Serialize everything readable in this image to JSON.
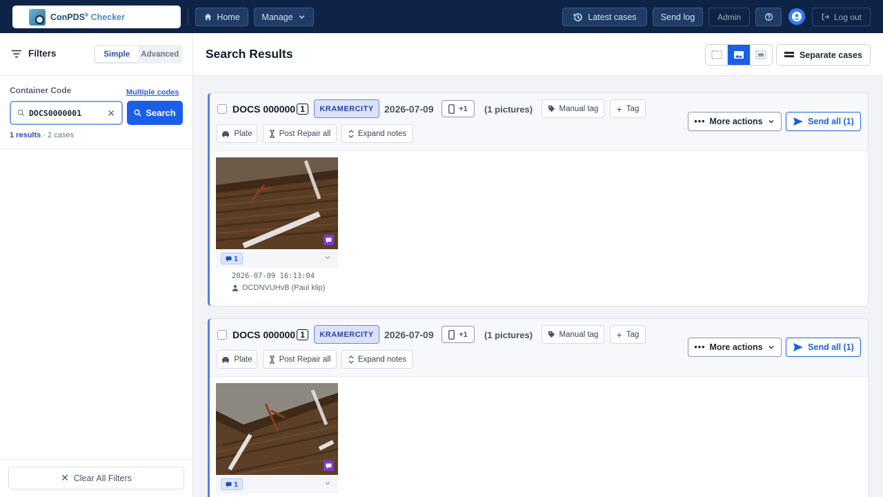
{
  "app": {
    "logo_name": "ConPDS",
    "logo_suffix": "Checker",
    "logo_reg": "®"
  },
  "topbar": {
    "home": "Home",
    "manage": "Manage",
    "latest": "Latest cases",
    "sendlog": "Send log",
    "admin": "Admin",
    "logout": "Log out"
  },
  "sidebar": {
    "title": "Filters",
    "mode_simple": "Simple",
    "mode_advanced": "Advanced",
    "container_label": "Container Code",
    "multiple_link": "Multiple codes",
    "search_value": "DOCS0000001",
    "search_button": "Search",
    "results_count": "1 results",
    "results_cases": "· 2 cases",
    "clear_all": "Clear All Filters"
  },
  "main": {
    "title": "Search Results",
    "separate": "Separate cases"
  },
  "cards": [
    {
      "code": "DOCS 000000",
      "code_num": "1",
      "city": "KRAMERCITY",
      "date": "2026-07-09",
      "device": "+1",
      "pictures": "(1 pictures)",
      "manual_tag": "Manual tag",
      "tag": "Tag",
      "plate": "Plate",
      "post_repair": "Post Repair all",
      "expand": "Expand notes",
      "more": "More actions",
      "send": "Send all (1)",
      "note_count": "1",
      "photo_time": "2026-07-09 16:13:04",
      "photo_user": "OCDNVUHvB (Paul klip)"
    },
    {
      "code": "DOCS 000000",
      "code_num": "1",
      "city": "KRAMERCITY",
      "date": "2026-07-09",
      "device": "+1",
      "pictures": "(1 pictures)",
      "manual_tag": "Manual tag",
      "tag": "Tag",
      "plate": "Plate",
      "post_repair": "Post Repair all",
      "expand": "Expand notes",
      "more": "More actions",
      "send": "Send all (1)",
      "note_count": "1"
    }
  ]
}
